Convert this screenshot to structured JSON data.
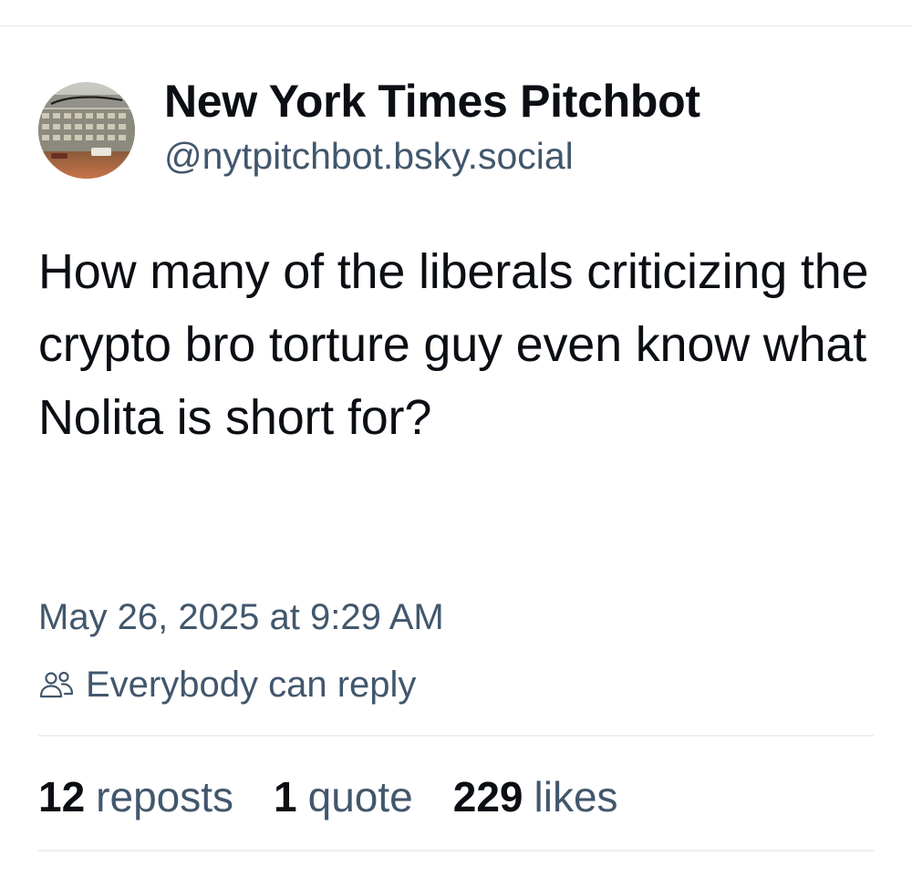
{
  "author": {
    "display_name": "New York Times Pitchbot",
    "handle": "@nytpitchbot.bsky.social",
    "avatar_icon": "newspaper-building-avatar"
  },
  "post": {
    "text": "How many of the liberals criticizing the crypto bro torture guy even know what Nolita is short for?",
    "timestamp": "May 26, 2025 at 9:29 AM",
    "reply_setting": "Everybody can reply",
    "reply_icon": "people-icon"
  },
  "stats": {
    "reposts": {
      "count": "12",
      "label": "reposts"
    },
    "quotes": {
      "count": "1",
      "label": "quote"
    },
    "likes": {
      "count": "229",
      "label": "likes"
    }
  },
  "colors": {
    "text_primary": "#0b0f14",
    "text_secondary": "#42576c",
    "divider": "#eceef1"
  }
}
